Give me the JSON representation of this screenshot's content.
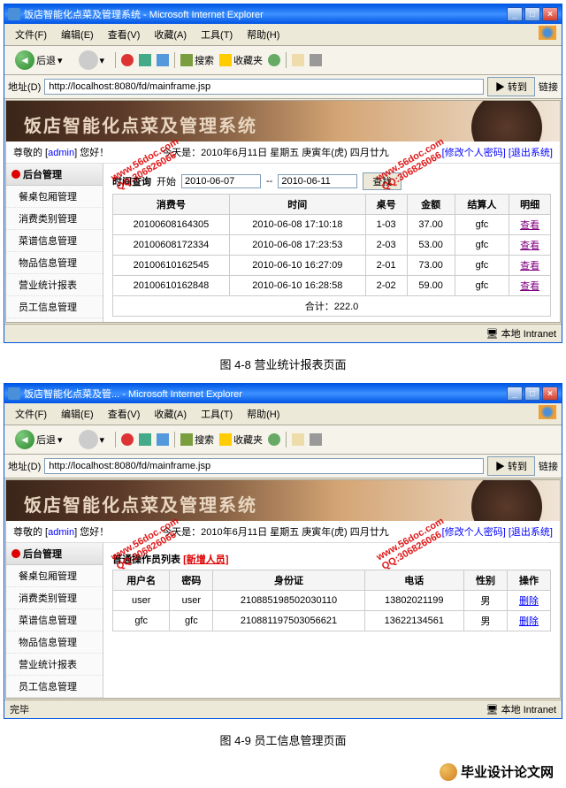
{
  "ie": {
    "title_full": "饭店智能化点菜及管理系统 - Microsoft Internet Explorer",
    "title_short": "饭店智能化点菜及管... - Microsoft Internet Explorer",
    "menu": {
      "file": "文件(F)",
      "edit": "编辑(E)",
      "view": "查看(V)",
      "fav": "收藏(A)",
      "tools": "工具(T)",
      "help": "帮助(H)"
    },
    "toolbar": {
      "back": "后退",
      "search": "搜索",
      "favorites": "收藏夹"
    },
    "addr_label": "地址(D)",
    "url": "http://localhost:8080/fd/mainframe.jsp",
    "go": "转到",
    "links": "链接",
    "status_done": "完毕",
    "status_zone": "本地 Intranet"
  },
  "app": {
    "banner_title": "饭店智能化点菜及管理系统",
    "greeting_prefix": "尊敬的 [",
    "user": "admin",
    "greeting_suffix": "] 您好！",
    "date_label": "今天是：2010年6月11日 星期五 庚寅年(虎) 四月廿九",
    "links": {
      "pwd": "[修改个人密码]",
      "logout": "[退出系统]"
    },
    "sidebar_title": "后台管理",
    "sidebar_items": [
      "餐桌包厢管理",
      "消费类别管理",
      "菜谱信息管理",
      "物品信息管理",
      "营业统计报表",
      "员工信息管理"
    ]
  },
  "report": {
    "query_label": "时间查询",
    "start_label": "开始",
    "from": "2010-06-07",
    "to": "2010-06-11",
    "to_sep": "--",
    "search_btn": "查找",
    "cols": [
      "消费号",
      "时间",
      "桌号",
      "金额",
      "结算人",
      "明细"
    ],
    "rows": [
      {
        "id": "20100608164305",
        "time": "2010-06-08 17:10:18",
        "table": "1-03",
        "amount": "37.00",
        "cashier": "gfc",
        "op": "查看"
      },
      {
        "id": "20100608172334",
        "time": "2010-06-08 17:23:53",
        "table": "2-03",
        "amount": "53.00",
        "cashier": "gfc",
        "op": "查看"
      },
      {
        "id": "20100610162545",
        "time": "2010-06-10 16:27:09",
        "table": "2-01",
        "amount": "73.00",
        "cashier": "gfc",
        "op": "查看"
      },
      {
        "id": "20100610162848",
        "time": "2010-06-10 16:28:58",
        "table": "2-02",
        "amount": "59.00",
        "cashier": "gfc",
        "op": "查看"
      }
    ],
    "total_label": "合计：",
    "total_value": "222.0"
  },
  "staff": {
    "title": "普通操作员列表",
    "add_link": "[新增人员]",
    "cols": [
      "用户名",
      "密码",
      "身份证",
      "电话",
      "性别",
      "操作"
    ],
    "rows": [
      {
        "user": "user",
        "pwd": "user",
        "idcard": "210885198502030110",
        "phone": "13802021199",
        "gender": "男",
        "op": "删除"
      },
      {
        "user": "gfc",
        "pwd": "gfc",
        "idcard": "210881197503056621",
        "phone": "13622134561",
        "gender": "男",
        "op": "删除"
      }
    ]
  },
  "captions": {
    "c1": "图 4-8 营业统计报表页面",
    "c2": "图 4-9 员工信息管理页面"
  },
  "watermark": {
    "site": "www.56doc.com",
    "qq": "QQ:306826066"
  },
  "footer": "毕业设计论文网"
}
